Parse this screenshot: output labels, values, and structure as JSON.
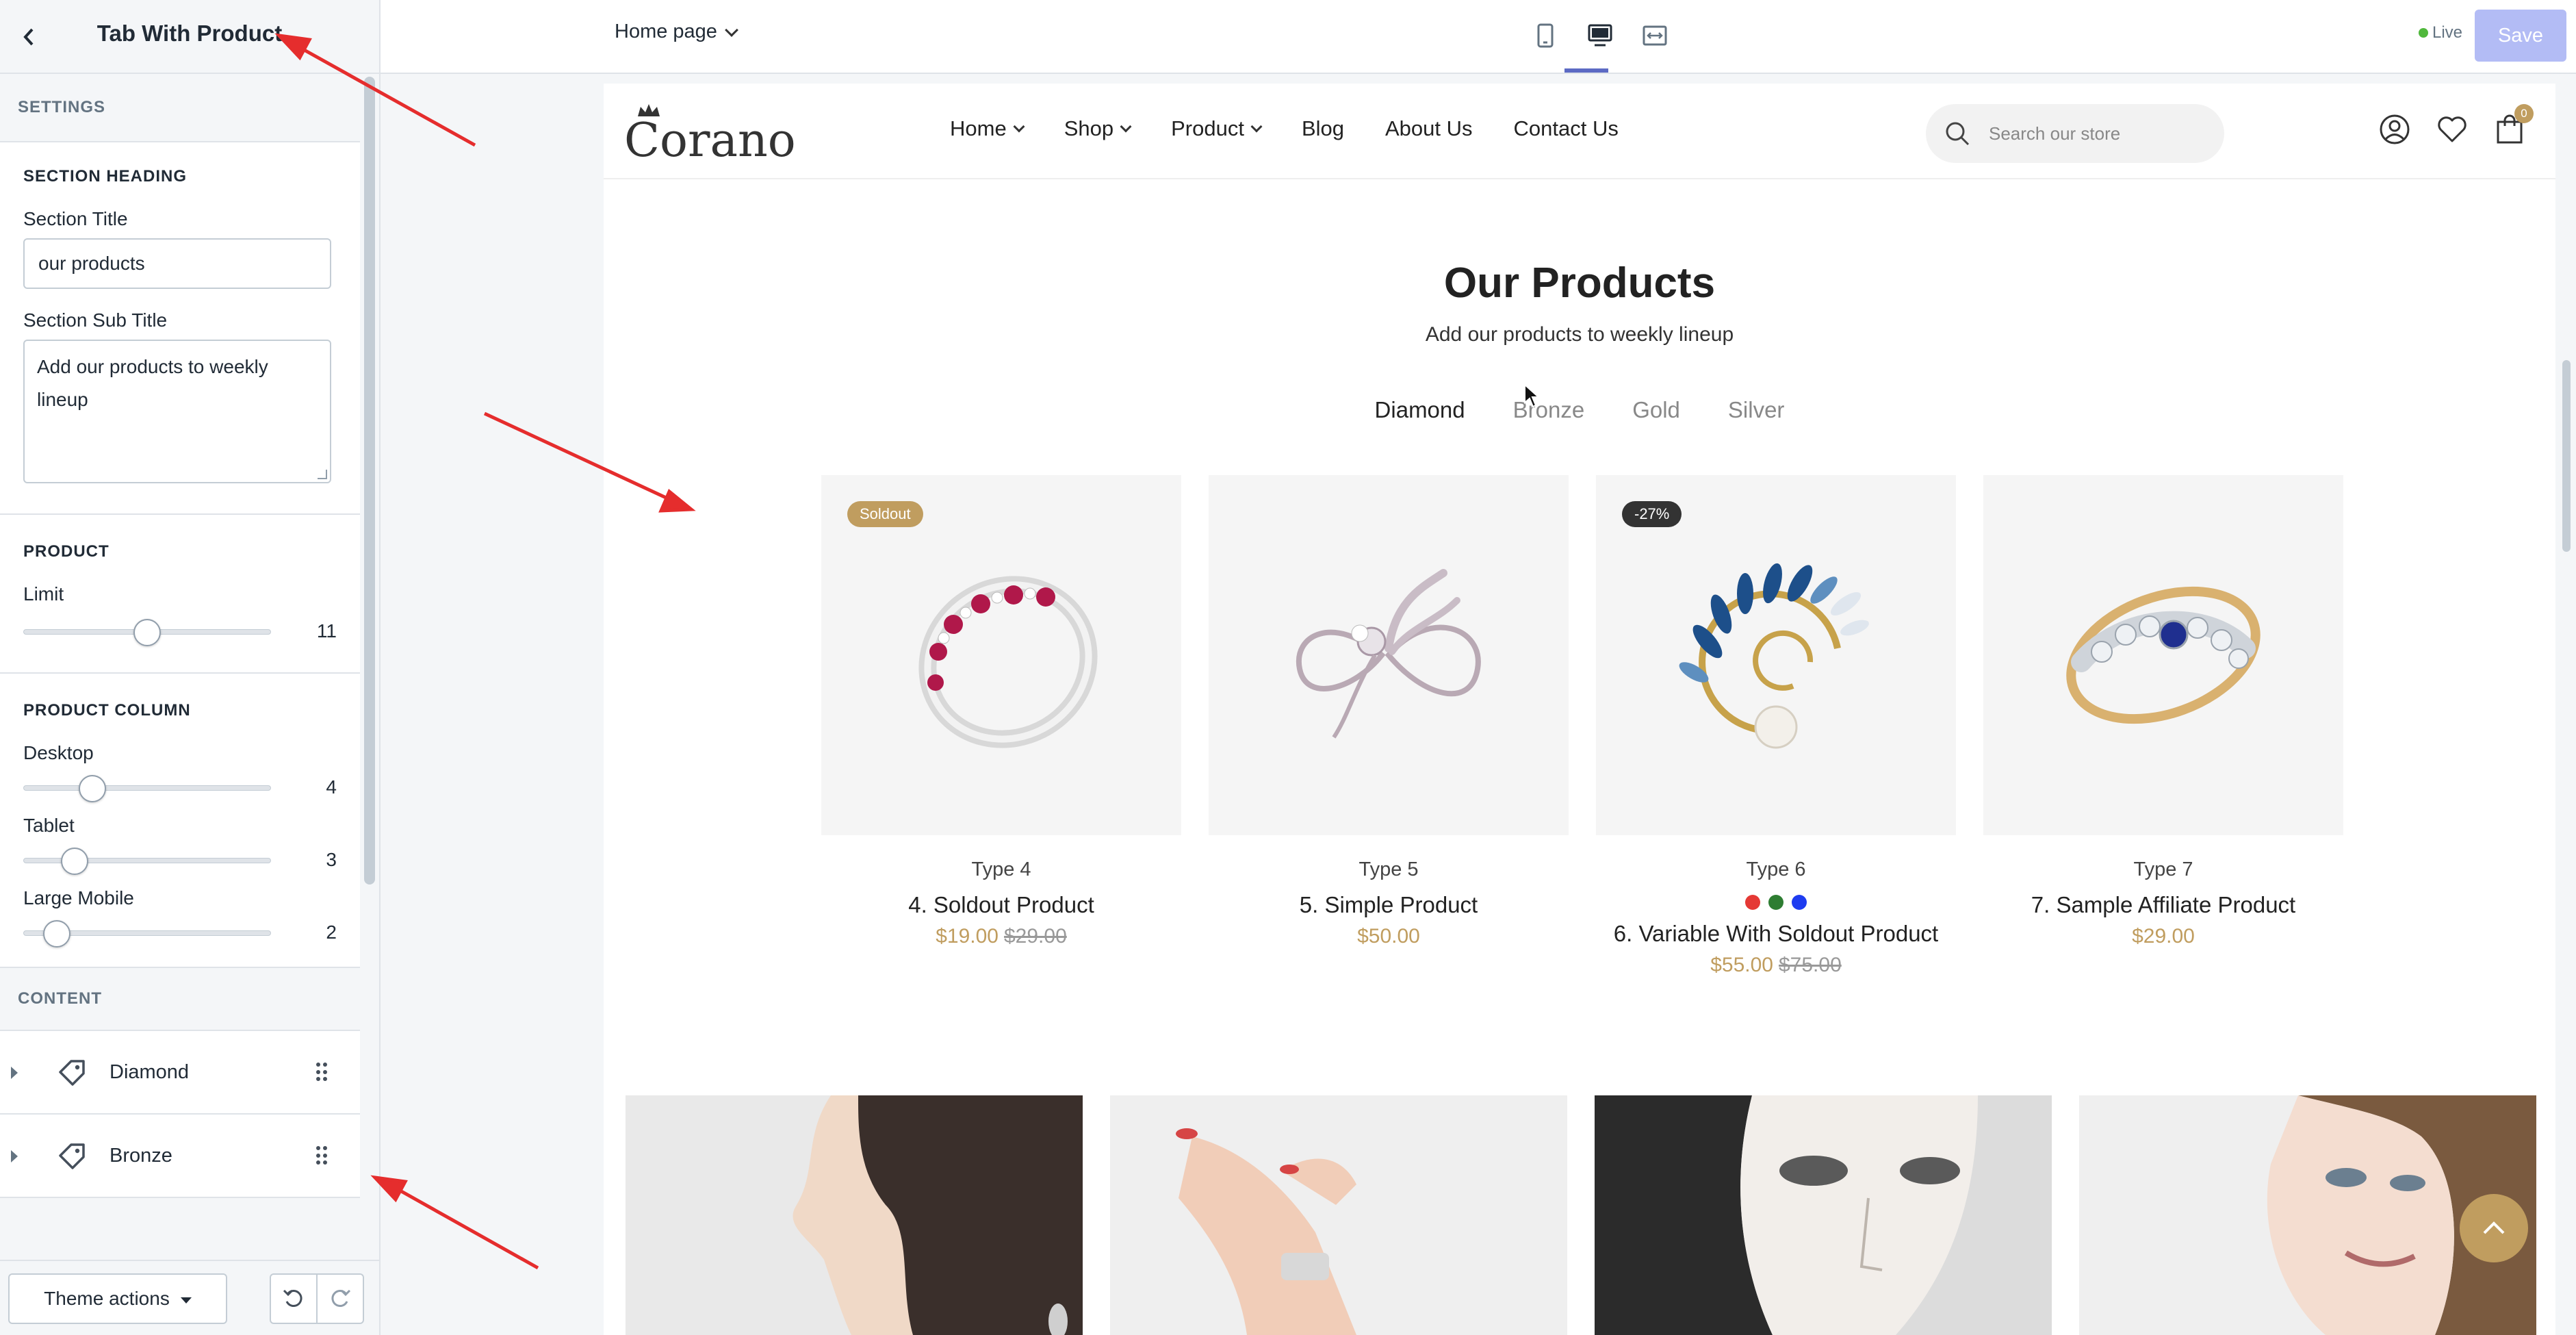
{
  "sidebar": {
    "title": "Tab With Product",
    "settings_label": "SETTINGS",
    "section_heading": {
      "heading": "SECTION HEADING",
      "title_label": "Section Title",
      "title_value": "our products",
      "subtitle_label": "Section Sub Title",
      "subtitle_value": "Add our products to weekly lineup"
    },
    "product": {
      "heading": "PRODUCT",
      "limit_label": "Limit",
      "limit_value": "11",
      "limit_fraction": 0.5
    },
    "product_column": {
      "heading": "PRODUCT COLUMN",
      "desktop_label": "Desktop",
      "desktop_value": "4",
      "desktop_fraction": 0.25,
      "tablet_label": "Tablet",
      "tablet_value": "3",
      "tablet_fraction": 0.17,
      "large_mobile_label": "Large Mobile",
      "large_mobile_value": "2",
      "large_mobile_fraction": 0.09
    },
    "content_label": "CONTENT",
    "blocks": [
      {
        "label": "Diamond",
        "icon": "tag-icon"
      },
      {
        "label": "Bronze",
        "icon": "tag-icon"
      }
    ],
    "footer": {
      "theme_actions": "Theme actions"
    }
  },
  "topbar": {
    "page_select": "Home page",
    "devices": [
      "mobile-icon",
      "desktop-icon",
      "fullwidth-icon"
    ],
    "active_device": "desktop-icon",
    "live_label": "Live",
    "save_label": "Save",
    "accent": "#5c6ac4"
  },
  "store": {
    "logo": "Corano",
    "nav": [
      {
        "label": "Home",
        "dropdown": true
      },
      {
        "label": "Shop",
        "dropdown": true
      },
      {
        "label": "Product",
        "dropdown": true
      },
      {
        "label": "Blog",
        "dropdown": false
      },
      {
        "label": "About Us",
        "dropdown": false
      },
      {
        "label": "Contact Us",
        "dropdown": false
      }
    ],
    "search_placeholder": "Search our store",
    "cart_count": "0",
    "brand_color": "#c09d5f"
  },
  "section": {
    "title": "Our Products",
    "subtitle": "Add our products to weekly lineup",
    "tabs": [
      "Diamond",
      "Bronze",
      "Gold",
      "Silver"
    ],
    "active_tab": "Diamond"
  },
  "products": [
    {
      "badge": "Soldout",
      "badge_type": "sold",
      "type": "Type 4",
      "name": "4. Soldout Product",
      "price": "$19.00",
      "compare_price": "$29.00",
      "swatches": [],
      "image": "ruby-ring"
    },
    {
      "badge": "",
      "badge_type": "",
      "type": "Type 5",
      "name": "5. Simple Product",
      "price": "$50.00",
      "compare_price": "",
      "swatches": [],
      "image": "flower-brooch"
    },
    {
      "badge": "-27%",
      "badge_type": "sale",
      "type": "Type 6",
      "name": "6. Variable With Soldout Product",
      "price": "$55.00",
      "compare_price": "$75.00",
      "swatches": [
        "#e53935",
        "#2e7d32",
        "#1e3cf0"
      ],
      "image": "sapphire-brooch"
    },
    {
      "badge": "",
      "badge_type": "",
      "type": "Type 7",
      "name": "7. Sample Affiliate Product",
      "price": "$29.00",
      "compare_price": "",
      "swatches": [],
      "image": "sapphire-ring"
    }
  ]
}
